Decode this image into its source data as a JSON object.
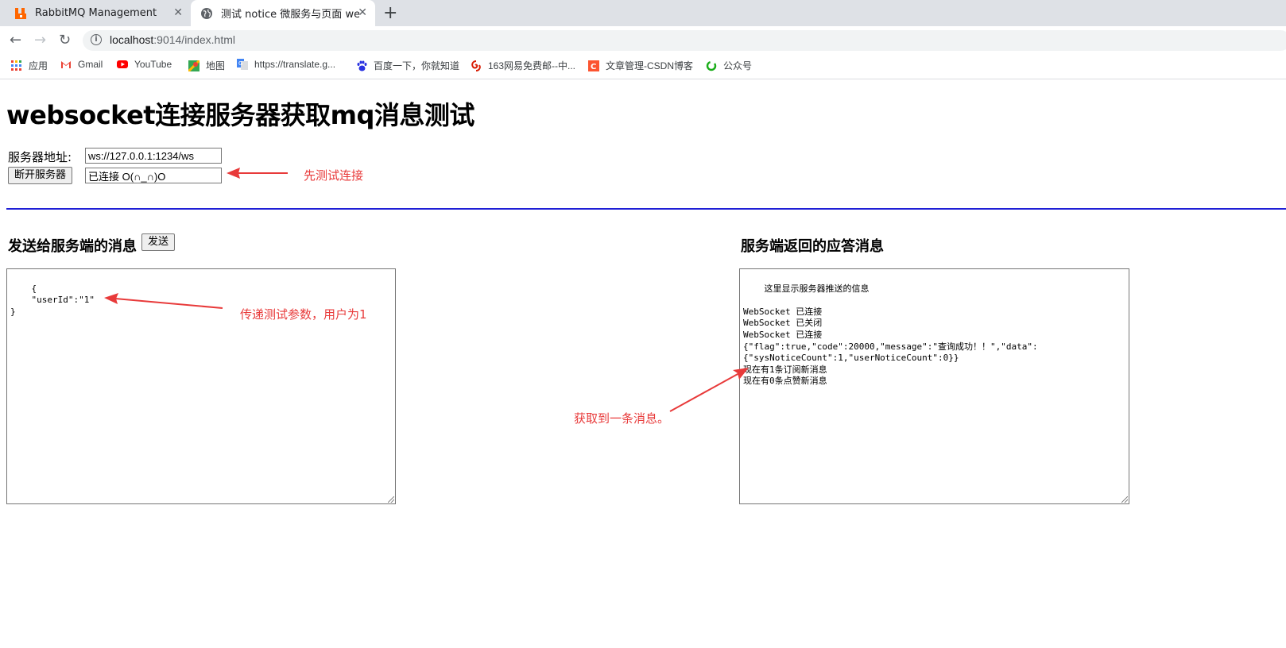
{
  "browser": {
    "tabs": [
      {
        "title": "RabbitMQ Management",
        "icon": "rabbitmq-icon",
        "active": false
      },
      {
        "title": "测试 notice 微服务与页面 websocket",
        "icon": "globe-icon",
        "active": true
      }
    ],
    "url_host": "localhost",
    "url_path": ":9014/index.html",
    "bookmarks": [
      {
        "label": "应用",
        "icon": "apps-grid-icon"
      },
      {
        "label": "Gmail",
        "icon": "gmail-icon"
      },
      {
        "label": "YouTube",
        "icon": "youtube-icon"
      },
      {
        "label": "地图",
        "icon": "maps-icon"
      },
      {
        "label": "https://translate.g...",
        "icon": "translate-icon"
      },
      {
        "label": "百度一下，你就知道",
        "icon": "baidu-paw-icon"
      },
      {
        "label": "163网易免费邮--中...",
        "icon": "netease-icon"
      },
      {
        "label": "文章管理-CSDN博客",
        "icon": "csdn-icon"
      },
      {
        "label": "公众号",
        "icon": "wechat-icon"
      }
    ]
  },
  "page": {
    "title": "websocket连接服务器获取mq消息测试",
    "server_label": "服务器地址:",
    "server_address": "ws://127.0.0.1:1234/ws",
    "disconnect_button": "断开服务器",
    "status_value": "已连接 O(∩_∩)O",
    "send_heading": "发送给服务端的消息",
    "send_button": "发送",
    "send_message": "{\n    \"userId\":\"1\"\n}",
    "response_heading": "服务端返回的应答消息",
    "response_text": "这里显示服务器推送的信息\n\nWebSocket 已连接\nWebSocket 已关闭\nWebSocket 已连接\n{\"flag\":true,\"code\":20000,\"message\":\"查询成功！！\",\"data\":\n{\"sysNoticeCount\":1,\"userNoticeCount\":0}}\n现在有1条订阅新消息\n现在有0条点赞新消息"
  },
  "annotations": {
    "connect_note": "先测试连接",
    "param_note": "传递测试参数，用户为1",
    "received_note": "获取到一条消息。",
    "color": "#e83a3a"
  },
  "colors": {
    "divider": "#1f1fd6",
    "tabstrip": "#dee1e6"
  }
}
